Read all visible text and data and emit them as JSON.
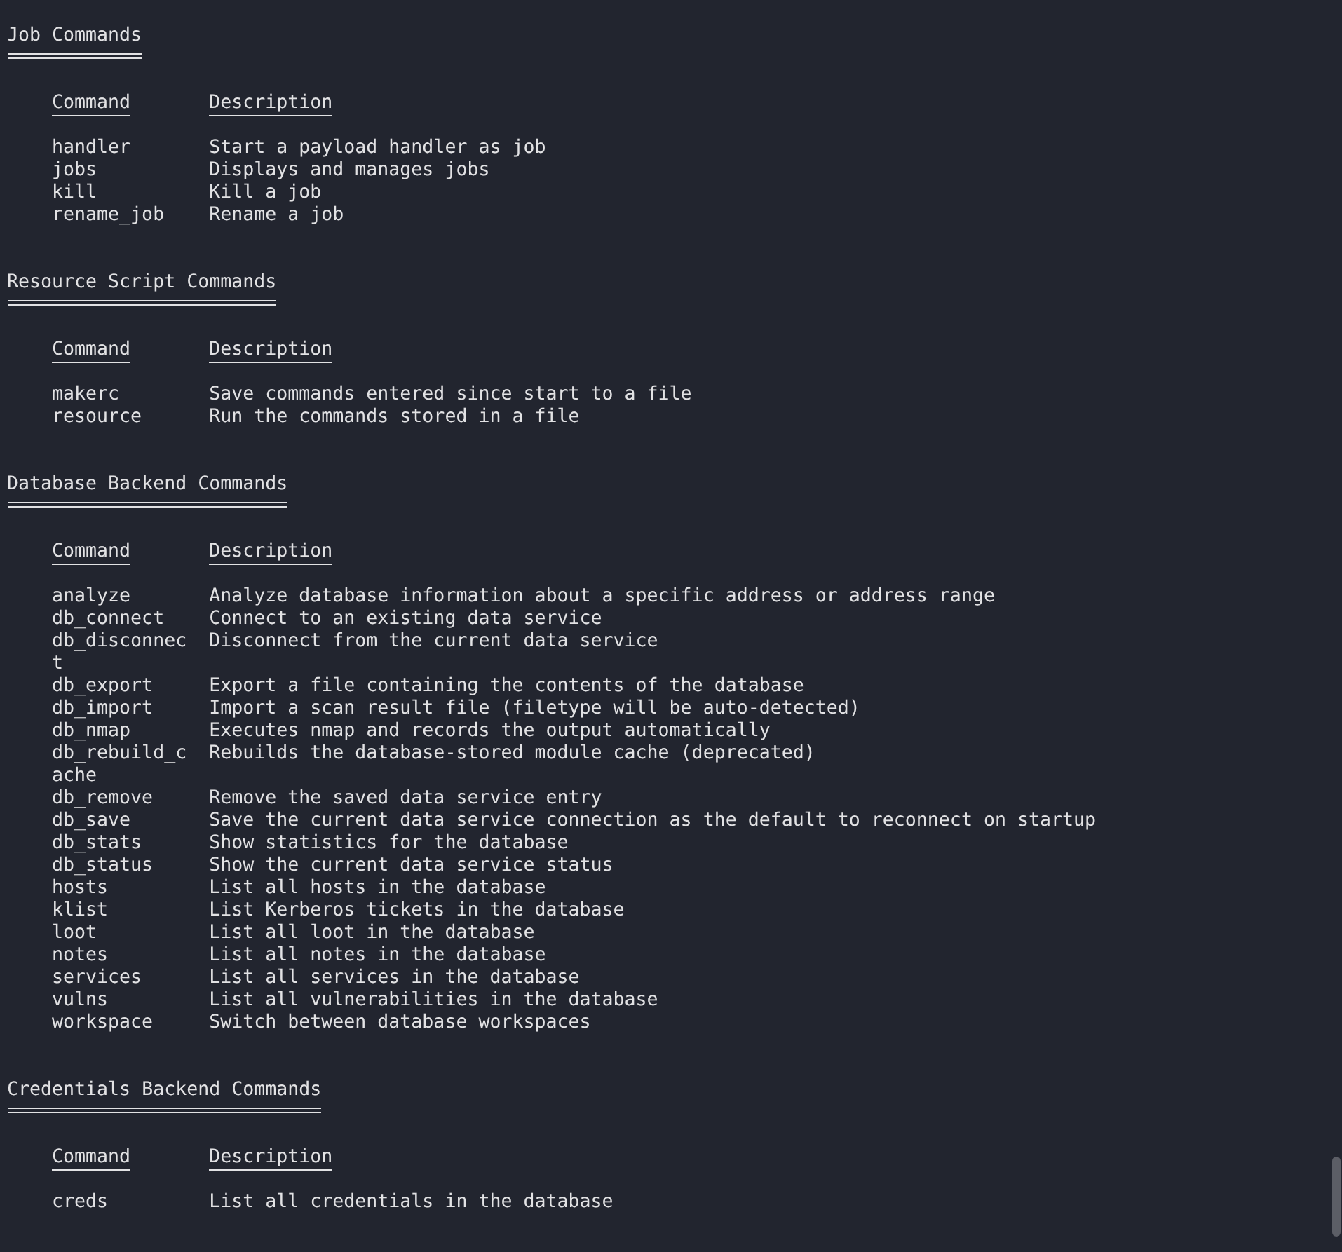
{
  "sections": [
    {
      "title": "Job Commands",
      "headers": [
        "Command",
        "Description"
      ],
      "rows": [
        {
          "command": "handler",
          "description": "Start a payload handler as job"
        },
        {
          "command": "jobs",
          "description": "Displays and manages jobs"
        },
        {
          "command": "kill",
          "description": "Kill a job"
        },
        {
          "command": "rename_job",
          "description": "Rename a job"
        }
      ]
    },
    {
      "title": "Resource Script Commands",
      "headers": [
        "Command",
        "Description"
      ],
      "rows": [
        {
          "command": "makerc",
          "description": "Save commands entered since start to a file"
        },
        {
          "command": "resource",
          "description": "Run the commands stored in a file"
        }
      ]
    },
    {
      "title": "Database Backend Commands",
      "headers": [
        "Command",
        "Description"
      ],
      "rows": [
        {
          "command": "analyze",
          "description": "Analyze database information about a specific address or address range"
        },
        {
          "command": "db_connect",
          "description": "Connect to an existing data service"
        },
        {
          "command": "db_disconnect",
          "description": "Disconnect from the current data service"
        },
        {
          "command": "db_export",
          "description": "Export a file containing the contents of the database"
        },
        {
          "command": "db_import",
          "description": "Import a scan result file (filetype will be auto-detected)"
        },
        {
          "command": "db_nmap",
          "description": "Executes nmap and records the output automatically"
        },
        {
          "command": "db_rebuild_cache",
          "description": "Rebuilds the database-stored module cache (deprecated)"
        },
        {
          "command": "db_remove",
          "description": "Remove the saved data service entry"
        },
        {
          "command": "db_save",
          "description": "Save the current data service connection as the default to reconnect on startup"
        },
        {
          "command": "db_stats",
          "description": "Show statistics for the database"
        },
        {
          "command": "db_status",
          "description": "Show the current data service status"
        },
        {
          "command": "hosts",
          "description": "List all hosts in the database"
        },
        {
          "command": "klist",
          "description": "List Kerberos tickets in the database"
        },
        {
          "command": "loot",
          "description": "List all loot in the database"
        },
        {
          "command": "notes",
          "description": "List all notes in the database"
        },
        {
          "command": "services",
          "description": "List all services in the database"
        },
        {
          "command": "vulns",
          "description": "List all vulnerabilities in the database"
        },
        {
          "command": "workspace",
          "description": "Switch between database workspaces"
        }
      ]
    },
    {
      "title": "Credentials Backend Commands",
      "headers": [
        "Command",
        "Description"
      ],
      "rows": [
        {
          "command": "creds",
          "description": "List all credentials in the database"
        }
      ]
    }
  ]
}
